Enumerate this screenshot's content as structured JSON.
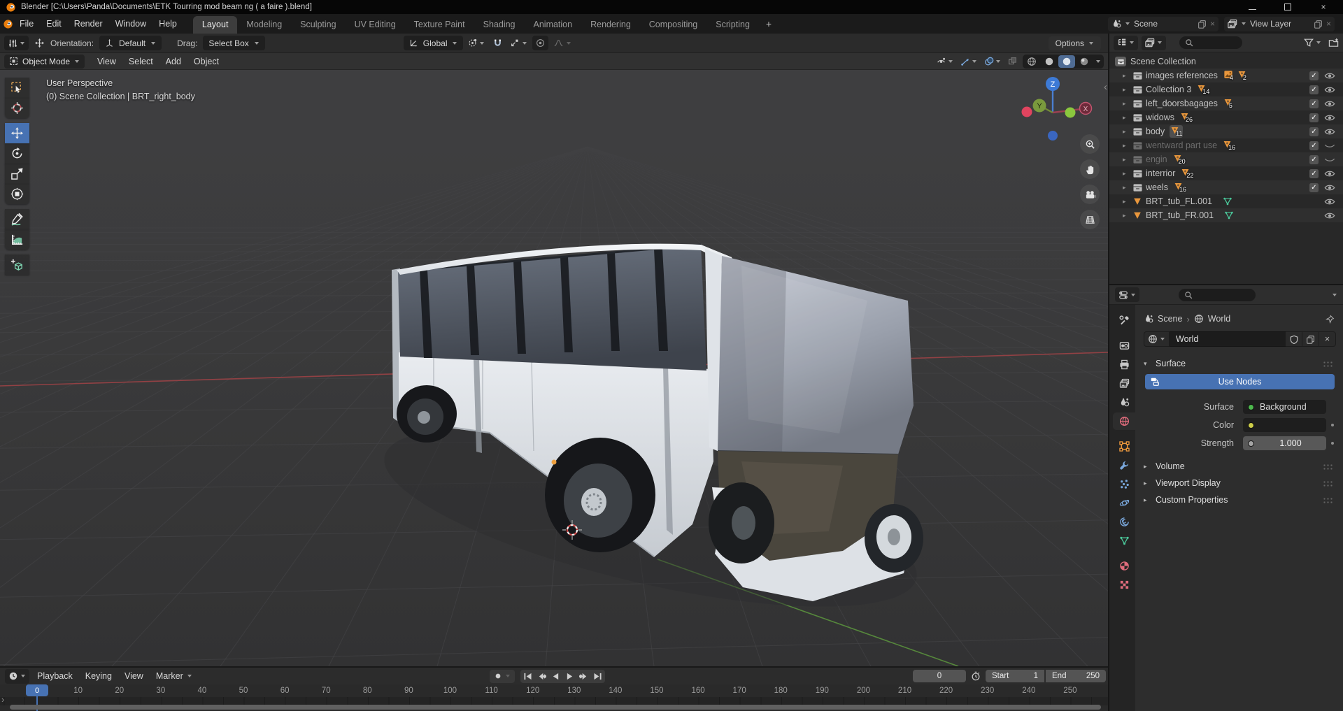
{
  "titlebar": {
    "title": "Blender [C:\\Users\\Panda\\Documents\\ETK Tourring mod beam ng ( a faire ).blend]"
  },
  "topbar": {
    "menus": [
      "File",
      "Edit",
      "Render",
      "Window",
      "Help"
    ],
    "tabs": [
      {
        "label": "Layout",
        "active": true
      },
      {
        "label": "Modeling"
      },
      {
        "label": "Sculpting"
      },
      {
        "label": "UV Editing"
      },
      {
        "label": "Texture Paint"
      },
      {
        "label": "Shading"
      },
      {
        "label": "Animation"
      },
      {
        "label": "Rendering"
      },
      {
        "label": "Compositing"
      },
      {
        "label": "Scripting"
      }
    ],
    "add_tab": "+",
    "scene_selector": {
      "value": "Scene"
    },
    "view_layer_selector": {
      "value": "View Layer"
    }
  },
  "tool_settings": {
    "orientation_label": "Orientation:",
    "orientation_value": "Default",
    "drag_label": "Drag:",
    "drag_value": "Select Box",
    "pivot_value": "Global",
    "options_label": "Options"
  },
  "viewport_header": {
    "mode": "Object Mode",
    "menus": [
      "View",
      "Select",
      "Add",
      "Object"
    ]
  },
  "viewport": {
    "overlay_line1": "User Perspective",
    "overlay_line2": "(0) Scene Collection | BRT_right_body",
    "tools": [
      {
        "name": "select-box"
      },
      {
        "name": "cursor",
        "grpend": true
      },
      {
        "name": "move",
        "active": true
      },
      {
        "name": "rotate"
      },
      {
        "name": "scale"
      },
      {
        "name": "transform",
        "grpend": true
      },
      {
        "name": "annotate"
      },
      {
        "name": "measure",
        "grpend": true
      },
      {
        "name": "add-cube",
        "solo": true
      }
    ],
    "gizmo_axes": {
      "x": "X",
      "y": "Y",
      "z": "Z"
    },
    "nav_buttons": [
      "nav-zoom",
      "nav-pan",
      "nav-camera",
      "nav-persp"
    ]
  },
  "outliner": {
    "root_label": "Scene Collection",
    "rows": [
      {
        "label": "images references",
        "badges": [
          {
            "kind": "image",
            "count": "4"
          },
          {
            "kind": "mesh",
            "count": "2"
          }
        ],
        "check": true,
        "eye": "open"
      },
      {
        "label": "Collection 3",
        "badges": [
          {
            "kind": "mesh",
            "count": "14"
          }
        ],
        "check": true,
        "eye": "open"
      },
      {
        "label": "left_doorsbagages",
        "badges": [
          {
            "kind": "mesh",
            "count": "5"
          }
        ],
        "check": true,
        "eye": "open"
      },
      {
        "label": "widows",
        "badges": [
          {
            "kind": "mesh",
            "count": "26"
          }
        ],
        "check": true,
        "eye": "open"
      },
      {
        "label": "body",
        "badges": [
          {
            "kind": "mesh",
            "count": "11"
          }
        ],
        "check": true,
        "eye": "open",
        "highlight": true
      },
      {
        "label": "wentward part use",
        "badges": [
          {
            "kind": "mesh",
            "count": "16"
          }
        ],
        "check": true,
        "eye": "closed",
        "dim": true
      },
      {
        "label": "engin",
        "badges": [
          {
            "kind": "mesh",
            "count": "20"
          }
        ],
        "check": true,
        "eye": "closed",
        "dim": true
      },
      {
        "label": "interrior",
        "badges": [
          {
            "kind": "mesh",
            "count": "22"
          }
        ],
        "check": true,
        "eye": "open"
      },
      {
        "label": "weels",
        "badges": [
          {
            "kind": "mesh",
            "count": "16"
          }
        ],
        "check": true,
        "eye": "open"
      },
      {
        "label": "BRT_tub_FL.001",
        "object": true,
        "eye": "open"
      },
      {
        "label": "BRT_tub_FR.001",
        "object": true,
        "eye": "open"
      }
    ]
  },
  "properties": {
    "tabs": [
      {
        "name": "tab-tool"
      },
      {
        "name": "tab-render",
        "gap": true
      },
      {
        "name": "tab-output"
      },
      {
        "name": "tab-view-layer"
      },
      {
        "name": "tab-scene"
      },
      {
        "name": "tab-world",
        "active": true
      },
      {
        "name": "tab-object",
        "gap": true
      },
      {
        "name": "tab-modifiers"
      },
      {
        "name": "tab-particles"
      },
      {
        "name": "tab-physics"
      },
      {
        "name": "tab-constraints"
      },
      {
        "name": "tab-object-data"
      },
      {
        "name": "tab-material",
        "gap": true
      },
      {
        "name": "tab-texture"
      }
    ],
    "breadcrumb": {
      "scene": "Scene",
      "world": "World"
    },
    "datablock_name": "World",
    "surface_panel": {
      "title": "Surface",
      "use_nodes": "Use Nodes",
      "surface_label": "Surface",
      "surface_value": "Background",
      "color_label": "Color",
      "strength_label": "Strength",
      "strength_value": "1.000",
      "socket_colors": {
        "surface": "#4DB94D",
        "color": "#CDCD49",
        "strength": "#A5A5A5"
      }
    },
    "collapsed_panels": [
      "Volume",
      "Viewport Display",
      "Custom Properties"
    ]
  },
  "timeline": {
    "menus": [
      "Playback",
      "Keying",
      "View",
      "Marker"
    ],
    "transport": [
      "jump-start",
      "prev-key",
      "play-back",
      "play",
      "next-key",
      "jump-end"
    ],
    "current_frame": "0",
    "start_label": "Start",
    "start_value": "1",
    "end_label": "End",
    "end_value": "250",
    "ruler_labels": [
      "0",
      "10",
      "20",
      "30",
      "40",
      "50",
      "60",
      "70",
      "80",
      "90",
      "100",
      "110",
      "120",
      "130",
      "140",
      "150",
      "160",
      "170",
      "180",
      "190",
      "200",
      "210",
      "220",
      "230",
      "240",
      "250"
    ]
  },
  "colors": {
    "accent": "#4772B3",
    "orange_icon": "#E9973C",
    "mesh_data_green": "#4BC99B",
    "world_tab_red": "#E06C7C"
  }
}
